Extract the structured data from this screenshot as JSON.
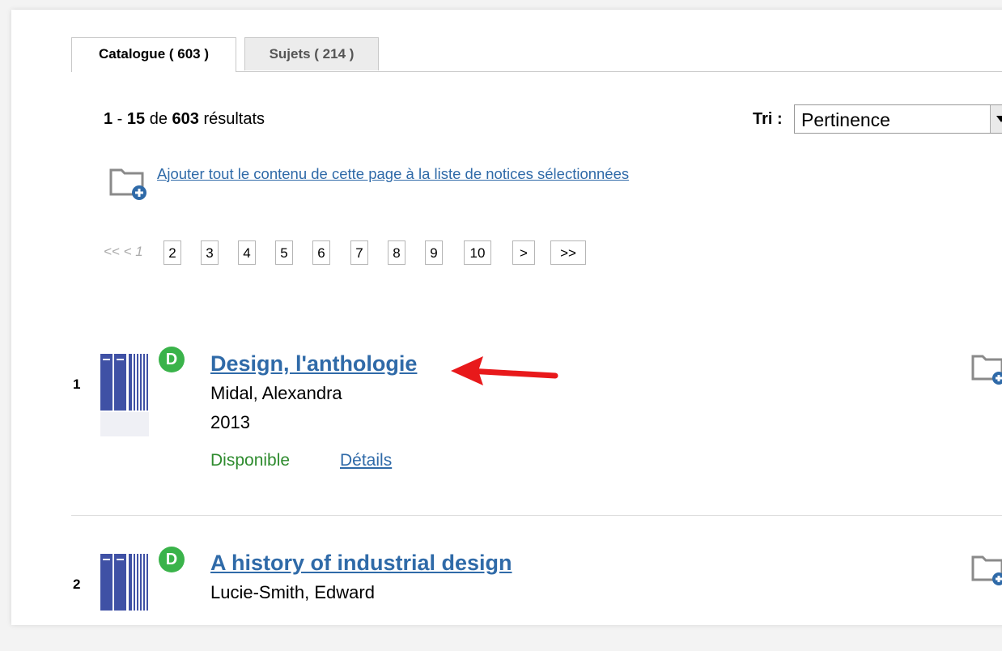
{
  "tabs": [
    {
      "label": "Catalogue ( 603 )",
      "active": true
    },
    {
      "label": "Sujets ( 214 )",
      "active": false
    }
  ],
  "results_summary": {
    "from": "1",
    "sep": " - ",
    "to": "15",
    "de": " de ",
    "total": "603",
    "suffix": " résultats"
  },
  "sort": {
    "label": "Tri :",
    "value": "Pertinence"
  },
  "add_all_link": "Ajouter tout le contenu de cette page à la liste de notices sélectionnées",
  "pagination": {
    "prev": "<< < 1",
    "pages": [
      "2",
      "3",
      "4",
      "5",
      "6",
      "7",
      "8",
      "9",
      "10"
    ],
    "next": ">",
    "last": ">>"
  },
  "results": [
    {
      "number": "1",
      "badge": "D",
      "title": "Design, l'anthologie",
      "author": "Midal, Alexandra",
      "year": "2013",
      "status": "Disponible",
      "details": "Détails"
    },
    {
      "number": "2",
      "badge": "D",
      "title": "A history of industrial design",
      "author": "Lucie-Smith, Edward"
    }
  ],
  "colors": {
    "link": "#2f6aa8",
    "available": "#2e8b2e",
    "badge": "#3ab34a",
    "book": "#3f51a5",
    "annotation_arrow": "#e8191b"
  },
  "icons": [
    "folder-add-icon",
    "book-cover-icon",
    "dropdown-arrow-icon",
    "red-arrow-annotation"
  ]
}
